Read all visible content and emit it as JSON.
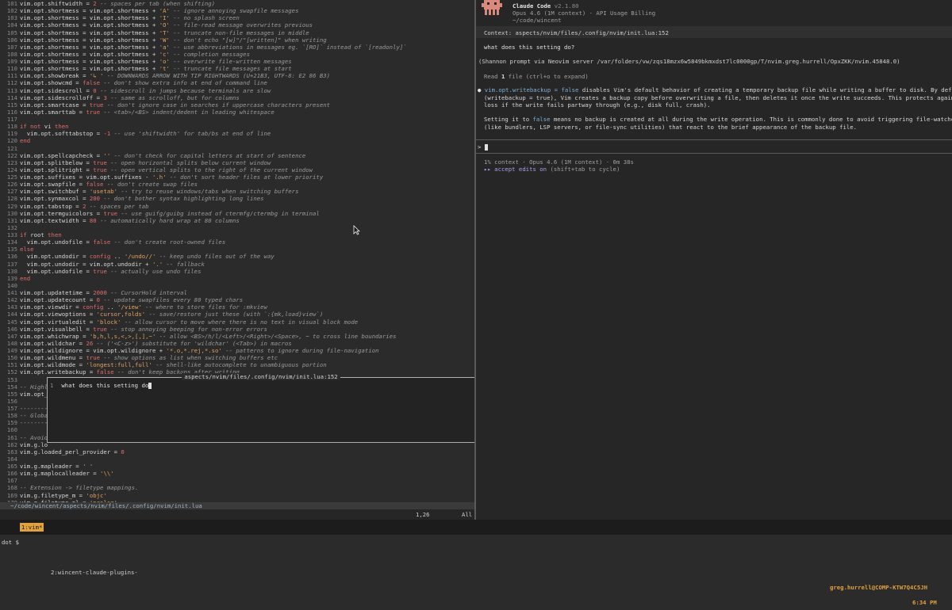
{
  "editor": {
    "lines": [
      {
        "n": "101",
        "t": [
          [
            "var",
            "vim.opt.shiftwidth = "
          ],
          [
            "numlit",
            "2"
          ],
          [
            "cm",
            " -- spaces per tab (when shifting)"
          ]
        ]
      },
      {
        "n": "102",
        "t": [
          [
            "var",
            "vim.opt.shortmess = vim.opt.shortmess + "
          ],
          [
            "str",
            "'A'"
          ],
          [
            "cm",
            " -- ignore annoying swapfile messages"
          ]
        ]
      },
      {
        "n": "103",
        "t": [
          [
            "var",
            "vim.opt.shortmess = vim.opt.shortmess + "
          ],
          [
            "str",
            "'I'"
          ],
          [
            "cm",
            " -- no splash screen"
          ]
        ]
      },
      {
        "n": "104",
        "t": [
          [
            "var",
            "vim.opt.shortmess = vim.opt.shortmess + "
          ],
          [
            "str",
            "'O'"
          ],
          [
            "cm",
            " -- file-read message overwrites previous"
          ]
        ]
      },
      {
        "n": "105",
        "t": [
          [
            "var",
            "vim.opt.shortmess = vim.opt.shortmess + "
          ],
          [
            "str",
            "'T'"
          ],
          [
            "cm",
            " -- truncate non-file messages in middle"
          ]
        ]
      },
      {
        "n": "106",
        "t": [
          [
            "var",
            "vim.opt.shortmess = vim.opt.shortmess + "
          ],
          [
            "str",
            "'W'"
          ],
          [
            "cm",
            " -- don't echo \"[w]\"/\"[written]\" when writing"
          ]
        ]
      },
      {
        "n": "107",
        "t": [
          [
            "var",
            "vim.opt.shortmess = vim.opt.shortmess + "
          ],
          [
            "str",
            "'a'"
          ],
          [
            "cm",
            " -- use abbreviations in messages eg. `[RO]` instead of `[readonly]`"
          ]
        ]
      },
      {
        "n": "108",
        "t": [
          [
            "var",
            "vim.opt.shortmess = vim.opt.shortmess + "
          ],
          [
            "str",
            "'c'"
          ],
          [
            "cm",
            " -- completion messages"
          ]
        ]
      },
      {
        "n": "109",
        "t": [
          [
            "var",
            "vim.opt.shortmess = vim.opt.shortmess + "
          ],
          [
            "str",
            "'o'"
          ],
          [
            "cm",
            " -- overwrite file-written messages"
          ]
        ]
      },
      {
        "n": "110",
        "t": [
          [
            "var",
            "vim.opt.shortmess = vim.opt.shortmess + "
          ],
          [
            "str",
            "'t'"
          ],
          [
            "cm",
            " -- truncate file messages at start"
          ]
        ]
      },
      {
        "n": "111",
        "t": [
          [
            "var",
            "vim.opt.showbreak = "
          ],
          [
            "str",
            "'↳ '"
          ],
          [
            "cm",
            " -- DOWNWARDS ARROW WITH TIP RIGHTWARDS (U+21B3, UTF-8: E2 86 B3)"
          ]
        ]
      },
      {
        "n": "112",
        "t": [
          [
            "var",
            "vim.opt.showcmd = "
          ],
          [
            "kw",
            "false"
          ],
          [
            "cm",
            " -- don't show extra info at end of command line"
          ]
        ]
      },
      {
        "n": "113",
        "t": [
          [
            "var",
            "vim.opt.sidescroll = "
          ],
          [
            "numlit",
            "0"
          ],
          [
            "cm",
            " -- sidescroll in jumps because terminals are slow"
          ]
        ]
      },
      {
        "n": "114",
        "t": [
          [
            "var",
            "vim.opt.sidescrolloff = "
          ],
          [
            "numlit",
            "3"
          ],
          [
            "cm",
            " -- same as scrolloff, but for columns"
          ]
        ]
      },
      {
        "n": "115",
        "t": [
          [
            "var",
            "vim.opt.smartcase = "
          ],
          [
            "kw",
            "true"
          ],
          [
            "cm",
            " -- don't ignore case in searches if uppercase characters present"
          ]
        ]
      },
      {
        "n": "116",
        "t": [
          [
            "var",
            "vim.opt.smarttab = "
          ],
          [
            "kw",
            "true"
          ],
          [
            "cm",
            " -- <tab>/<BS> indent/dedent in leading whitespace"
          ]
        ]
      },
      {
        "n": "117",
        "t": []
      },
      {
        "n": "118",
        "t": [
          [
            "kw",
            "if not "
          ],
          [
            "var",
            "vi "
          ],
          [
            "kw",
            "then"
          ]
        ]
      },
      {
        "n": "119",
        "t": [
          [
            "var",
            "  vim.opt.softtabstop = "
          ],
          [
            "numlit",
            "-1"
          ],
          [
            "cm",
            " -- use 'shiftwidth' for tab/bs at end of line"
          ]
        ]
      },
      {
        "n": "120",
        "t": [
          [
            "kw",
            "end"
          ]
        ]
      },
      {
        "n": "121",
        "t": []
      },
      {
        "n": "122",
        "t": [
          [
            "var",
            "vim.opt.spellcapcheck = "
          ],
          [
            "str",
            "''"
          ],
          [
            "cm",
            " -- don't check for capital letters at start of sentence"
          ]
        ]
      },
      {
        "n": "123",
        "t": [
          [
            "var",
            "vim.opt.splitbelow = "
          ],
          [
            "kw",
            "true"
          ],
          [
            "cm",
            " -- open horizontal splits below current window"
          ]
        ]
      },
      {
        "n": "124",
        "t": [
          [
            "var",
            "vim.opt.splitright = "
          ],
          [
            "kw",
            "true"
          ],
          [
            "cm",
            " -- open vertical splits to the right of the current window"
          ]
        ]
      },
      {
        "n": "125",
        "t": [
          [
            "var",
            "vim.opt.suffixes = vim.opt.suffixes - "
          ],
          [
            "str",
            "'.h'"
          ],
          [
            "cm",
            " -- don't sort header files at lower priority"
          ]
        ]
      },
      {
        "n": "126",
        "t": [
          [
            "var",
            "vim.opt.swapfile = "
          ],
          [
            "kw",
            "false"
          ],
          [
            "cm",
            " -- don't create swap files"
          ]
        ]
      },
      {
        "n": "127",
        "t": [
          [
            "var",
            "vim.opt.switchbuf = "
          ],
          [
            "str",
            "'usetab'"
          ],
          [
            "cm",
            " -- try to reuse windows/tabs when switching buffers"
          ]
        ]
      },
      {
        "n": "128",
        "t": [
          [
            "var",
            "vim.opt.synmaxcol = "
          ],
          [
            "numlit",
            "200"
          ],
          [
            "cm",
            " -- don't bother syntax highlighting long lines"
          ]
        ]
      },
      {
        "n": "129",
        "t": [
          [
            "var",
            "vim.opt.tabstop = "
          ],
          [
            "numlit",
            "2"
          ],
          [
            "cm",
            " -- spaces per tab"
          ]
        ]
      },
      {
        "n": "130",
        "t": [
          [
            "var",
            "vim.opt.termguicolors = "
          ],
          [
            "kw",
            "true"
          ],
          [
            "cm",
            " -- use guifg/guibg instead of ctermfg/ctermbg in terminal"
          ]
        ]
      },
      {
        "n": "131",
        "t": [
          [
            "var",
            "vim.opt.textwidth = "
          ],
          [
            "numlit",
            "80"
          ],
          [
            "cm",
            " -- automatically hard wrap at 80 columns"
          ]
        ]
      },
      {
        "n": "132",
        "t": []
      },
      {
        "n": "133",
        "t": [
          [
            "kw",
            "if "
          ],
          [
            "var",
            "root "
          ],
          [
            "kw",
            "then"
          ]
        ]
      },
      {
        "n": "134",
        "t": [
          [
            "var",
            "  vim.opt.undofile = "
          ],
          [
            "kw",
            "false"
          ],
          [
            "cm",
            " -- don't create root-owned files"
          ]
        ]
      },
      {
        "n": "135",
        "t": [
          [
            "kw",
            "else"
          ]
        ]
      },
      {
        "n": "136",
        "t": [
          [
            "var",
            "  vim.opt.undodir = "
          ],
          [
            "kw",
            "config"
          ],
          [
            "var",
            " .. "
          ],
          [
            "str",
            "'/undo//'"
          ],
          [
            "cm",
            " -- keep undo files out of the way"
          ]
        ]
      },
      {
        "n": "137",
        "t": [
          [
            "var",
            "  vim.opt.undodir = vim.opt.undodir + "
          ],
          [
            "str",
            "'.'"
          ],
          [
            "cm",
            " -- fallback"
          ]
        ]
      },
      {
        "n": "138",
        "t": [
          [
            "var",
            "  vim.opt.undofile = "
          ],
          [
            "kw",
            "true"
          ],
          [
            "cm",
            " -- actually use undo files"
          ]
        ]
      },
      {
        "n": "139",
        "t": [
          [
            "kw",
            "end"
          ]
        ]
      },
      {
        "n": "140",
        "t": []
      },
      {
        "n": "141",
        "t": [
          [
            "var",
            "vim.opt.updatetime = "
          ],
          [
            "numlit",
            "2000"
          ],
          [
            "cm",
            " -- CursorHold interval"
          ]
        ]
      },
      {
        "n": "142",
        "t": [
          [
            "var",
            "vim.opt.updatecount = "
          ],
          [
            "numlit",
            "0"
          ],
          [
            "cm",
            " -- update swapfiles every 80 typed chars"
          ]
        ]
      },
      {
        "n": "143",
        "t": [
          [
            "var",
            "vim.opt.viewdir = "
          ],
          [
            "kw",
            "config"
          ],
          [
            "var",
            " .. "
          ],
          [
            "str",
            "'/view'"
          ],
          [
            "cm",
            " -- where to store files for :mkview"
          ]
        ]
      },
      {
        "n": "144",
        "t": [
          [
            "var",
            "vim.opt.viewoptions = "
          ],
          [
            "str",
            "'cursor,folds'"
          ],
          [
            "cm",
            " -- save/restore just these (with `:{mk,load}view`)"
          ]
        ]
      },
      {
        "n": "145",
        "t": [
          [
            "var",
            "vim.opt.virtualedit = "
          ],
          [
            "str",
            "'block'"
          ],
          [
            "cm",
            " -- allow cursor to move where there is no text in visual block mode"
          ]
        ]
      },
      {
        "n": "146",
        "t": [
          [
            "var",
            "vim.opt.visualbell = "
          ],
          [
            "kw",
            "true"
          ],
          [
            "cm",
            " -- stop annoying beeping for non-error errors"
          ]
        ]
      },
      {
        "n": "147",
        "t": [
          [
            "var",
            "vim.opt.whichwrap = "
          ],
          [
            "str",
            "'b,h,l,s,<,>,[,],~'"
          ],
          [
            "cm",
            " -- allow <BS>/h/l/<Left>/<Right>/<Space>, ~ to cross line boundaries"
          ]
        ]
      },
      {
        "n": "148",
        "t": [
          [
            "var",
            "vim.opt.wildchar = "
          ],
          [
            "numlit",
            "26"
          ],
          [
            "cm",
            " -- ('<C-z>') substitute for 'wildchar' (<Tab>) in macros"
          ]
        ]
      },
      {
        "n": "149",
        "t": [
          [
            "var",
            "vim.opt.wildignore = vim.opt.wildignore + "
          ],
          [
            "str",
            "'*.o,*.rej,*.so'"
          ],
          [
            "cm",
            " -- patterns to ignore during file-navigation"
          ]
        ]
      },
      {
        "n": "150",
        "t": [
          [
            "var",
            "vim.opt.wildmenu = "
          ],
          [
            "kw",
            "true"
          ],
          [
            "cm",
            " -- show options as list when switching buffers etc"
          ]
        ]
      },
      {
        "n": "151",
        "t": [
          [
            "var",
            "vim.opt.wildmode = "
          ],
          [
            "str",
            "'longest:full,full'"
          ],
          [
            "cm",
            " -- shell-like autocomplete to unambiguous portion"
          ]
        ]
      },
      {
        "n": "152",
        "t": [
          [
            "var",
            "vim.opt.writebackup = "
          ],
          [
            "kw",
            "false"
          ],
          [
            "cm",
            " -- don't keep backups after writing"
          ]
        ]
      },
      {
        "n": "153",
        "t": []
      },
      {
        "n": "154",
        "t": [
          [
            "cm",
            "-- Highl"
          ]
        ]
      },
      {
        "n": "155",
        "t": [
          [
            "var",
            "vim.opt_"
          ]
        ]
      },
      {
        "n": "156",
        "t": []
      },
      {
        "n": "157",
        "t": [
          [
            "cm",
            "--------"
          ]
        ]
      },
      {
        "n": "158",
        "t": [
          [
            "cm",
            "-- Globa"
          ]
        ]
      },
      {
        "n": "159",
        "t": [
          [
            "cm",
            "--------"
          ]
        ]
      },
      {
        "n": "160",
        "t": []
      },
      {
        "n": "161",
        "t": [
          [
            "cm",
            "-- Avoid"
          ]
        ]
      },
      {
        "n": "162",
        "t": [
          [
            "var",
            "vim.g.lo"
          ]
        ]
      },
      {
        "n": "163",
        "t": [
          [
            "var",
            "vim.g.loaded_perl_provider = "
          ],
          [
            "numlit",
            "0"
          ]
        ]
      },
      {
        "n": "164",
        "t": []
      },
      {
        "n": "165",
        "t": [
          [
            "var",
            "vim.g.mapleader = "
          ],
          [
            "str",
            "' '"
          ]
        ]
      },
      {
        "n": "166",
        "t": [
          [
            "var",
            "vim.g.maplocalleader = "
          ],
          [
            "str",
            "'\\\\'"
          ]
        ]
      },
      {
        "n": "167",
        "t": []
      },
      {
        "n": "168",
        "t": [
          [
            "cm",
            "-- Extension -> filetype mappings."
          ]
        ]
      },
      {
        "n": "169",
        "t": [
          [
            "var",
            "vim.g.filetype_m = "
          ],
          [
            "str",
            "'objc'"
          ]
        ]
      },
      {
        "n": "170",
        "t": [
          [
            "var",
            "vim.g.filetype_pl = "
          ],
          [
            "str",
            "'prolog'"
          ]
        ]
      }
    ],
    "statusline": "   ~/code/wincent/aspects/nvim/files/.config/nvim/init.lua",
    "ruler_pos": "1,26",
    "ruler_all": "All",
    "float_title": "aspects/nvim/files/.config/nvim/init.lua:152",
    "float_line_num": "1",
    "float_text": "what does this setting do"
  },
  "claude": {
    "title": "Claude Code",
    "version": "v2.1.80",
    "model_line": "Opus 4.6 (1M context) · API Usage Billing",
    "cwd": "~/code/wincent",
    "context_label": "Context: aspects/nvim/files/.config/nvim/init.lua:152",
    "question": "what does this setting do?",
    "prompt_via": "(Shannon prompt via Neovim server /var/folders/vw/zqs18mzx6w5849bkmxdst7lc0000gp/T/nvim.greg.hurrell/OpxZKK/nvim.45848.0)",
    "read_prefix": "Read ",
    "read_count": "1",
    "read_suffix": " file (ctrl+o to expand)",
    "answer_code": "vim.opt.writebackup = false",
    "answer_p1_rest": " disables Vim's default behavior of creating a temporary backup file while writing a buffer to disk. By default",
    "answer_p1_l2": "(writebackup = true), Vim creates a backup copy before overwriting a file, then deletes it once the write succeeds. This protects against data",
    "answer_p1_l3": "loss if the write fails partway through (e.g., disk full, crash).",
    "answer_p2_a": "Setting it to ",
    "answer_p2_code": "false",
    "answer_p2_b": " means no backup is created at all during the write operation. This is commonly done to avoid triggering file-watcher tools",
    "answer_p2_l2": "(like bundlers, LSP servers, or file-sync utilities) that react to the brief appearance of the backup file.",
    "prompt_symbol": ">",
    "status_line": "1% context · Opus 4.6 (1M context) · 0m 38s",
    "accept_bold": "▸▸ accept edits on",
    "accept_hint": " (shift+tab to cycle)"
  },
  "tmux": {
    "session": "dot $",
    "window1": "1:vim*",
    "window2": "2:wincent-claude-plugins-",
    "host": "greg.hurrell@COMP-KTW7Q4C5JH",
    "time": "6:34 PM"
  },
  "colors": {
    "accent": "#e3a13a",
    "keyword": "#e26d6d",
    "string": "#e3a35c",
    "link": "#7fb1d6",
    "logo": "#d98a7c"
  }
}
